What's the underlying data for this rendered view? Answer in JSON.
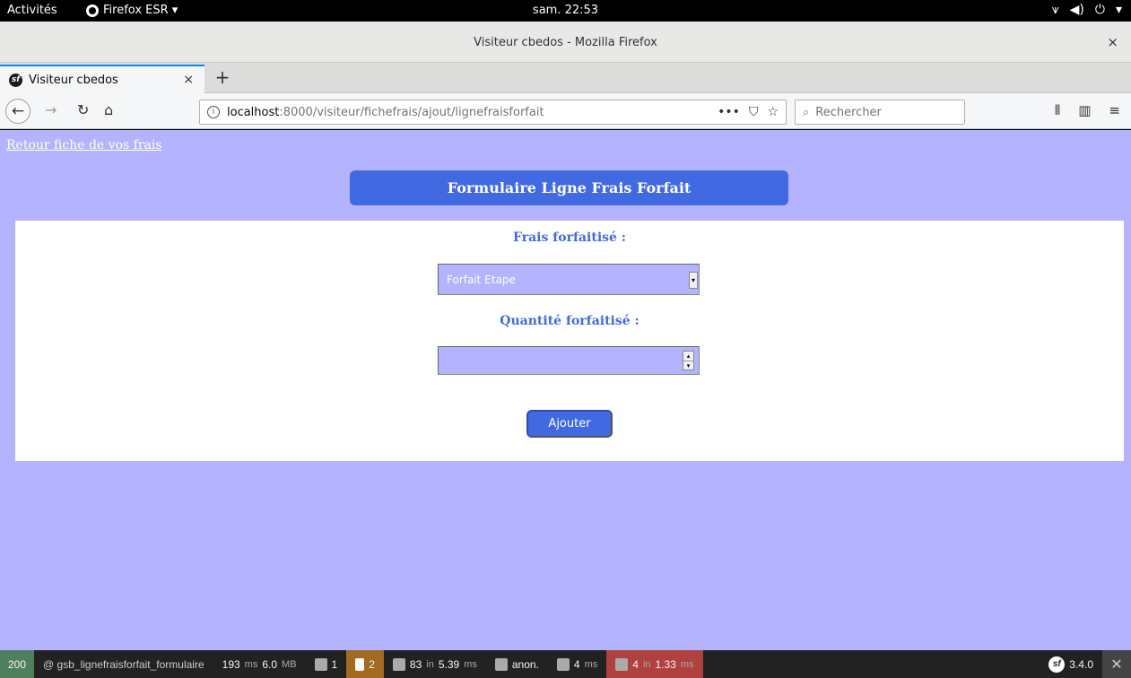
{
  "system_bar": {
    "activities": "Activités",
    "app_name": "Firefox ESR ▾",
    "clock": "sam. 22:53"
  },
  "window": {
    "title": "Visiteur cbedos - Mozilla Firefox",
    "close": "×"
  },
  "tabs": [
    {
      "label": "Visiteur cbedos",
      "close": "×",
      "active": true
    }
  ],
  "new_tab": "+",
  "navbar": {
    "url_host": "localhost",
    "url_path": ":8000/visiteur/fichefrais/ajout/lignefraisforfait",
    "page_actions": "•••",
    "search_placeholder": "Rechercher"
  },
  "page": {
    "back_link": "Retour fiche de vos frais",
    "heading": "Formulaire Ligne Frais Forfait",
    "form": {
      "frais_label": "Frais forfaitisé :",
      "frais_selected": "Forfait Etape",
      "quantite_label": "Quantité forfaitisé :",
      "quantite_value": "",
      "submit_label": "Ajouter"
    },
    "colors": {
      "background": "#b3b3ff",
      "accent": "#4169e1"
    }
  },
  "debug_toolbar": {
    "status_code": "200",
    "route": "@ gsb_lignefraisforfait_formulaire",
    "time_value": "193",
    "time_unit": "ms",
    "memory_value": "6.0",
    "memory_unit": "MB",
    "forms_count": "1",
    "logs_count": "2",
    "cache_count": "83",
    "cache_in": "in",
    "cache_time": "5.39",
    "cache_unit": "ms",
    "user": "anon.",
    "twig_time": "4",
    "twig_unit": "ms",
    "db_count": "4",
    "db_in": "in",
    "db_time": "1.33",
    "db_unit": "ms",
    "version": "3.4.0",
    "hide": "✕"
  }
}
